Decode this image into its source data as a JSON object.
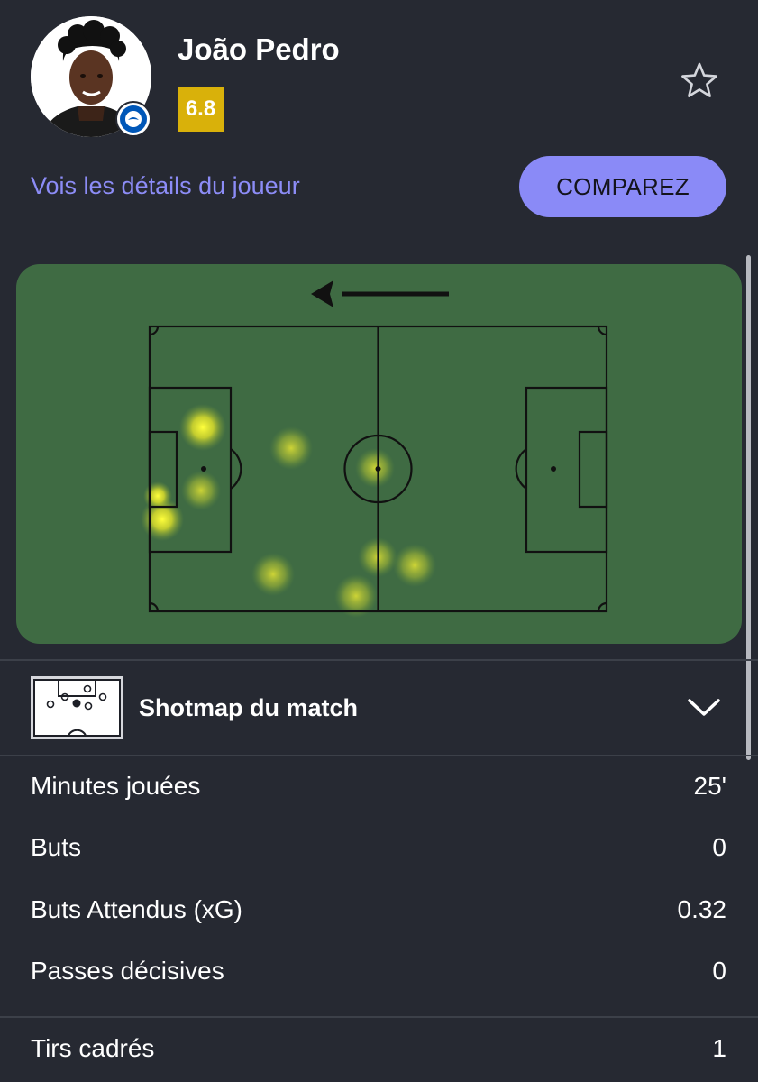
{
  "player": {
    "name": "João Pedro",
    "rating": "6.8",
    "rating_color": "#d9b10a"
  },
  "actions": {
    "details_link": "Vois les détails du joueur",
    "compare_button": "COMPAREZ"
  },
  "heatmap": {
    "direction_icon": "arrow-left-icon",
    "pitch_color": "#3f6b43"
  },
  "shotmap": {
    "label": "Shotmap du match",
    "icon": "pitch-icon",
    "toggle_icon": "chevron-down-icon"
  },
  "stats": [
    {
      "label": "Minutes jouées",
      "value": "25'"
    },
    {
      "label": "Buts",
      "value": "0"
    },
    {
      "label": "Buts Attendus (xG)",
      "value": "0.32"
    },
    {
      "label": "Passes décisives",
      "value": "0"
    },
    {
      "label": "Tirs cadrés",
      "value": "1"
    }
  ],
  "colors": {
    "background": "#262932",
    "accent": "#8a8af7",
    "link": "#8c8cf6"
  }
}
